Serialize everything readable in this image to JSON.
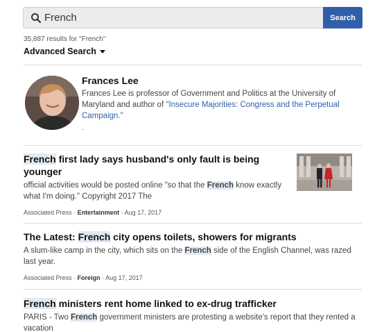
{
  "search": {
    "query": "French",
    "button_label": "Search"
  },
  "results_count": "35,887 results for \"French\"",
  "advanced_search_label": "Advanced Search",
  "profile": {
    "name": "Frances Lee",
    "bio_text": "Frances Lee is professor of Government and Politics at the University of Maryland and author of ",
    "bio_link": "\"Insecure Majorities: Congress and the Perpetual Campaign.\"",
    "trailing": "."
  },
  "articles": [
    {
      "title_highlight": "French",
      "title_rest": " first lady says husband's only fault is being younger",
      "excerpt_pre": "official activities would be posted online \"so that the ",
      "excerpt_highlight": "French",
      "excerpt_post": " know exactly what I'm doing.\" Copyright 2017 The",
      "source": "Associated Press",
      "section": "Entertainment",
      "date": "Aug 17, 2017"
    },
    {
      "title_pre": "The Latest: ",
      "title_highlight": "French",
      "title_rest": " city opens toilets, showers for migrants",
      "excerpt_pre": "A slum-like camp in the city, which sits on the ",
      "excerpt_highlight": "French",
      "excerpt_post": " side of the English Channel, was razed last year.",
      "source": "Associated Press",
      "section": "Foreign",
      "date": "Aug 17, 2017"
    },
    {
      "title_highlight": "French",
      "title_rest": " ministers rent home linked to ex-drug trafficker",
      "excerpt_pre": "PARIS - Two ",
      "excerpt_highlight": "French",
      "excerpt_post": " government ministers are protesting a website's report that they rented a vacation"
    }
  ],
  "meta_separator": "·",
  "colors": {
    "accent": "#2f5fa8",
    "highlight": "#e1e9f4"
  }
}
